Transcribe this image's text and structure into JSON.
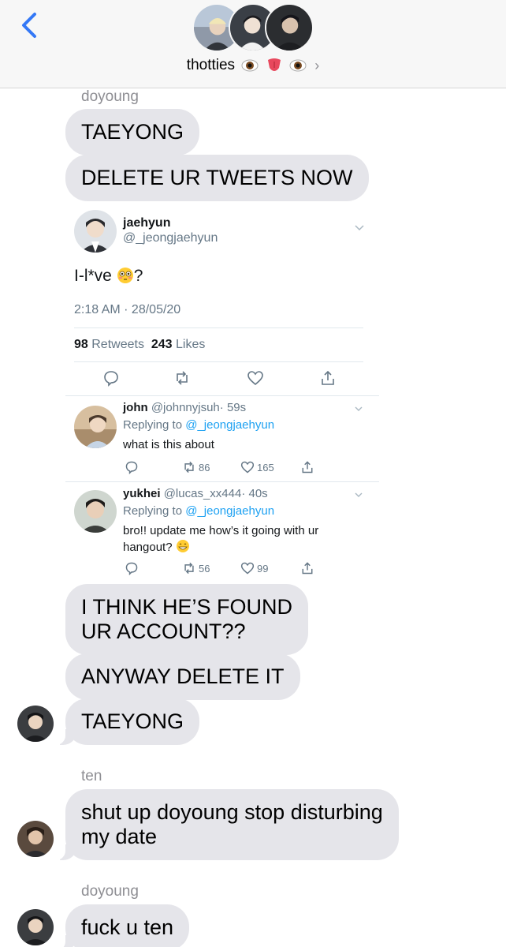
{
  "header": {
    "title": "thotties",
    "title_emojis": [
      "eye-icon",
      "tongue-icon",
      "eye-icon"
    ],
    "accent": "#3478f6"
  },
  "messages": {
    "block1": {
      "sender": "doyoung",
      "bubble1": "TAEYONG",
      "bubble2": "DELETE UR TWEETS NOW"
    },
    "block2": {
      "bubble1_line1": "I THINK HE’S FOUND",
      "bubble1_line2": "UR ACCOUNT??",
      "bubble2": "ANYWAY DELETE IT",
      "bubble3": "TAEYONG"
    },
    "block3": {
      "sender": "ten",
      "line1": "shut up doyoung stop disturbing",
      "line2": "my date"
    },
    "block4": {
      "sender": "doyoung",
      "bubble1": "fuck u ten"
    }
  },
  "tweet": {
    "name": "jaehyun",
    "handle": "@_jeongjaehyun",
    "text": "I-l*ve",
    "text_suffix": "?",
    "emoji": "flushed-face-icon",
    "time": "2:18 AM · 28/05/20",
    "retweets": "98",
    "retweets_label": "Retweets",
    "likes": "243",
    "likes_label": "Likes",
    "replies": [
      {
        "name": "john",
        "handle": "@johnnyjsuh",
        "age": "· 59s",
        "replying_prefix": "Replying to",
        "replying_to": "@_jeongjaehyun",
        "text": "what is this about",
        "retweets": "86",
        "likes": "165"
      },
      {
        "name": "yukhei",
        "handle": "@lucas_xx444",
        "age": "· 40s",
        "replying_prefix": "Replying to",
        "replying_to": "@_jeongjaehyun",
        "text": "bro!! update me how’s it going with ur hangout?",
        "retweets": "56",
        "likes": "99"
      }
    ]
  },
  "colors": {
    "bubble": "#e5e5ea",
    "twitter_blue": "#1da1f2",
    "twitter_gray": "#657786"
  }
}
